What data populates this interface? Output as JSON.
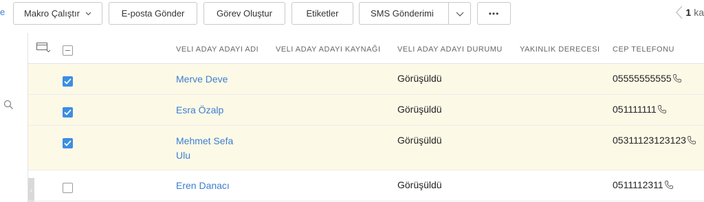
{
  "toolbar": {
    "edge_text": "e",
    "macro_label": "Makro Çalıştır",
    "email_label": "E-posta Gönder",
    "task_label": "Görev Oluştur",
    "tags_label": "Etiketler",
    "sms_label": "SMS Gönderimi",
    "more_label": "•••"
  },
  "pager": {
    "current": "1",
    "rest": "ka"
  },
  "columns": {
    "name": "VELI ADAY ADAYI ADI",
    "source": "VELI ADAY ADAYI KAYNAĞI",
    "status": "VELI ADAY ADAYI DURUMU",
    "closeness": "YAKINLIK DERECESI",
    "phone": "CEP TELEFONU"
  },
  "rows": [
    {
      "name": "Merve Deve",
      "source": "",
      "status": "Görüşüldü",
      "closeness": "",
      "phone": "05555555555",
      "checked": true
    },
    {
      "name": "Esra Özalp",
      "source": "",
      "status": "Görüşüldü",
      "closeness": "",
      "phone": "051111111",
      "checked": true
    },
    {
      "name_line1": "Mehmet Sefa",
      "name_line2": "Ulu",
      "source": "",
      "status": "Görüşüldü",
      "closeness": "",
      "phone": "05311123123123",
      "checked": true
    },
    {
      "name": "Eren Danacı",
      "source": "",
      "status": "Görüşüldü",
      "closeness": "",
      "phone": "0511112311",
      "checked": false
    }
  ],
  "colors": {
    "link": "#3b7fcf",
    "selected_row": "#fdf9e7",
    "checkbox": "#3c8ee3"
  }
}
